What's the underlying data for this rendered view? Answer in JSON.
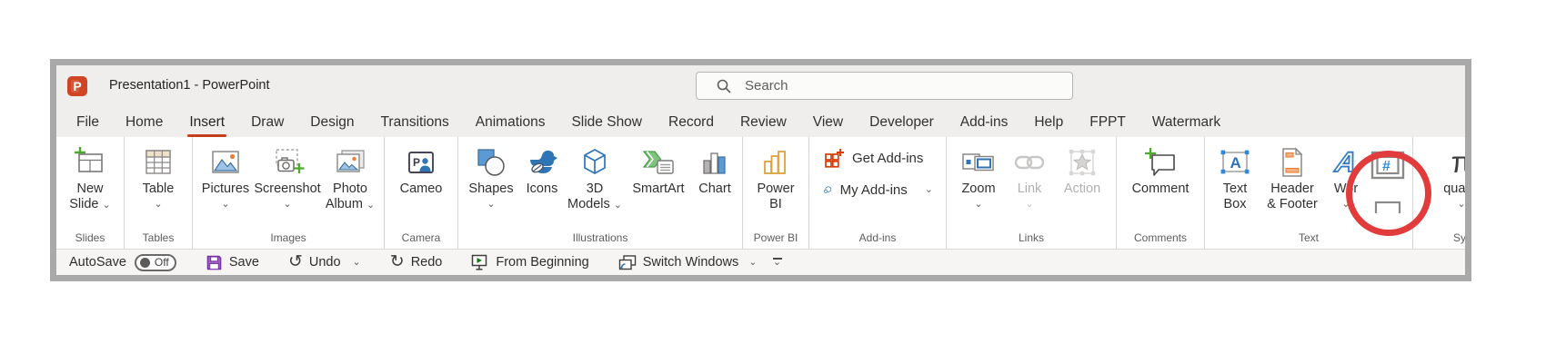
{
  "window": {
    "title": "Presentation1  -  PowerPoint"
  },
  "titlebar": {
    "search_placeholder": "Search"
  },
  "menu": {
    "active_tab": "Insert",
    "tabs": [
      "File",
      "Home",
      "Insert",
      "Draw",
      "Design",
      "Transitions",
      "Animations",
      "Slide Show",
      "Record",
      "Review",
      "View",
      "Developer",
      "Add-ins",
      "Help",
      "FPPT",
      "Watermark"
    ]
  },
  "ribbon": {
    "groups": [
      {
        "label": "Slides",
        "items": [
          {
            "icon": "new-slide-icon",
            "line1": "New",
            "line2": "Slide"
          }
        ]
      },
      {
        "label": "Tables",
        "items": [
          {
            "icon": "table-icon",
            "line1": "Table"
          }
        ]
      },
      {
        "label": "Images",
        "items": [
          {
            "icon": "pictures-icon",
            "line1": "Pictures"
          },
          {
            "icon": "screenshot-icon",
            "line1": "Screenshot"
          },
          {
            "icon": "photo-album-icon",
            "line1": "Photo",
            "line2": "Album"
          }
        ]
      },
      {
        "label": "Camera",
        "items": [
          {
            "icon": "cameo-icon",
            "line1": "Cameo"
          }
        ]
      },
      {
        "label": "Illustrations",
        "items": [
          {
            "icon": "shapes-icon",
            "line1": "Shapes"
          },
          {
            "icon": "icons-duck-icon",
            "line1": "Icons"
          },
          {
            "icon": "3d-models-icon",
            "line1": "3D",
            "line2": "Models"
          },
          {
            "icon": "smartart-icon",
            "line1": "SmartArt"
          },
          {
            "icon": "chart-icon",
            "line1": "Chart"
          }
        ]
      },
      {
        "label": "Power BI",
        "items": [
          {
            "icon": "power-bi-icon",
            "line1": "Power",
            "line2": "BI"
          }
        ]
      },
      {
        "label": "Add-ins",
        "items": [
          {
            "icon": "get-addins-icon",
            "line1": "Get Add-ins"
          },
          {
            "icon": "my-addins-icon",
            "line1": "My Add-ins"
          }
        ]
      },
      {
        "label": "Links",
        "items": [
          {
            "icon": "zoom-icon",
            "line1": "Zoom"
          },
          {
            "icon": "link-icon",
            "line1": "Link",
            "disabled": true
          },
          {
            "icon": "action-icon",
            "line1": "Action",
            "disabled": true
          }
        ]
      },
      {
        "label": "Comments",
        "items": [
          {
            "icon": "comment-icon",
            "line1": "Comment"
          }
        ]
      },
      {
        "label": "Text",
        "items": [
          {
            "icon": "text-box-icon",
            "line1": "Text",
            "line2": "Box"
          },
          {
            "icon": "header-footer-icon",
            "line1": "Header",
            "line2": "& Footer"
          },
          {
            "icon": "wordart-icon",
            "line1": "Wor"
          },
          {
            "icon": "slide-number-icon"
          },
          {
            "icon": "object-icon"
          }
        ]
      },
      {
        "label": "Sy",
        "items": [
          {
            "icon": "equation-icon",
            "line1": "quatio"
          }
        ]
      }
    ]
  },
  "glyphs": {
    "logo": "P",
    "cameo_letter": "P",
    "textbox_letter": "A",
    "wordart_letter": "A",
    "slide_number": "#",
    "equation": "π"
  },
  "qat": {
    "autosave": "AutoSave",
    "autosave_state": "Off",
    "save": "Save",
    "undo": "Undo",
    "redo": "Redo",
    "from_beginning": "From Beginning",
    "switch_windows": "Switch Windows"
  },
  "annotation": {
    "highlight_color": "#e23b3b"
  },
  "colors": {
    "accent_underline": "#c43e1c",
    "logo_background": "#d04423",
    "highlight_circle": "#e23b3b",
    "save_icon": "#a05fc5",
    "green_plus": "#4ea72e",
    "blue_accent": "#2e75b6"
  }
}
